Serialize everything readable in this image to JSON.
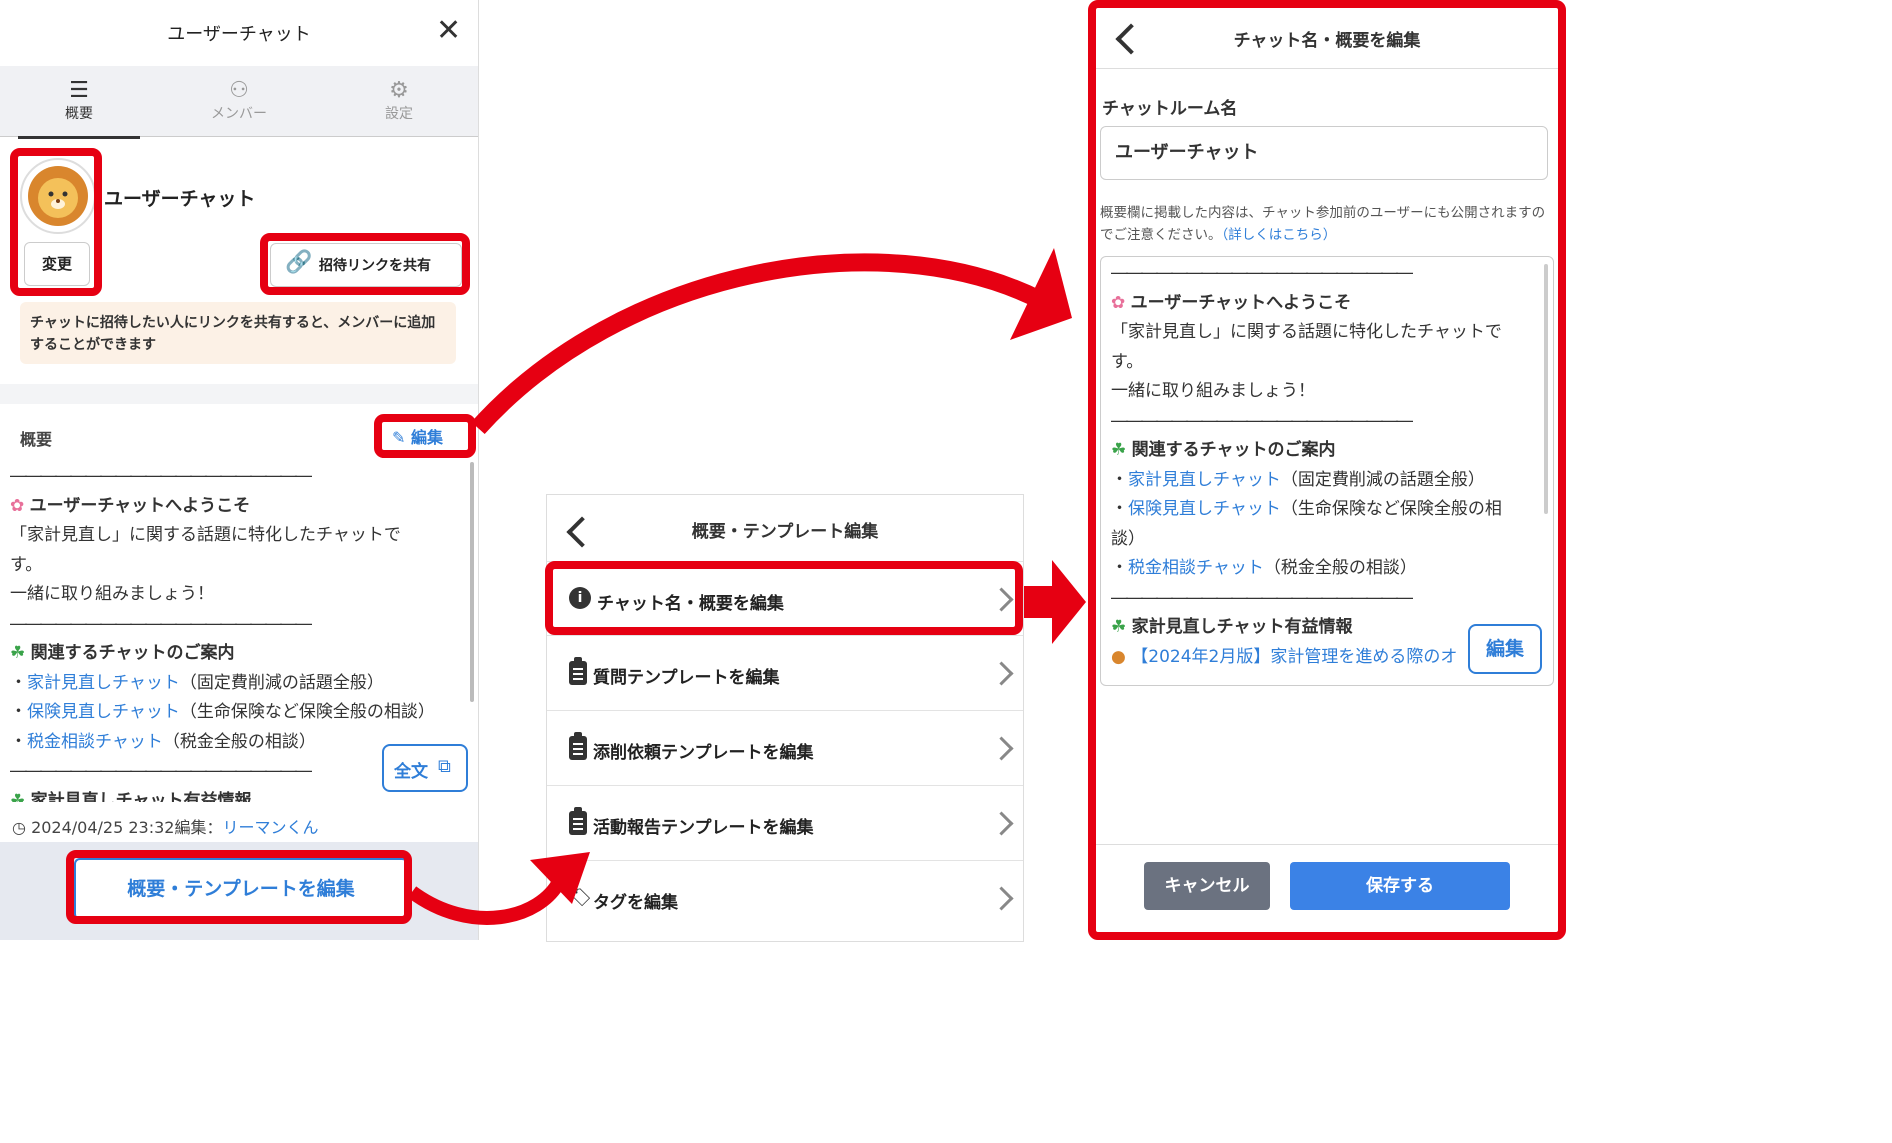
{
  "left": {
    "title": "ユーザーチャット",
    "tabs": [
      {
        "label": "概要",
        "icon": "list-icon"
      },
      {
        "label": "メンバー",
        "icon": "person-icon"
      },
      {
        "label": "設定",
        "icon": "gear-icon"
      }
    ],
    "chat_name": "ユーザーチャット",
    "change_button": "変更",
    "share_button": "招待リンクを共有",
    "tooltip": "チャットに招待したい人にリンクを共有すると、メンバーに追加することができます",
    "overview_label": "概要",
    "edit_label": "編集",
    "overview_lines": {
      "sep": "――――――――――――――――――――",
      "welcome": "ユーザーチャットへようこそ",
      "line1": "「家計見直し」に関する話題に特化したチャットで",
      "line2": "す。",
      "line3": "一緒に取り組みましょう！",
      "related": "関連するチャットのご案内",
      "items": [
        {
          "link": "家計見直しチャット",
          "desc": "（固定費削減の話題全般）"
        },
        {
          "link": "保険見直しチャット",
          "desc": "（生命保険など保険全般の相談）"
        },
        {
          "link": "税金相談チャット",
          "desc": "（税金全般の相談）"
        }
      ],
      "cut": "家計見直しチャット有益情報"
    },
    "fulltext_button": "全文",
    "edited_info": "2024/04/25  23:32編集：",
    "edited_by": "リーマンくん",
    "bottom_button": "概要・テンプレートを編集"
  },
  "middle": {
    "title": "概要・テンプレート編集",
    "items": [
      {
        "label": "チャット名・概要を編集",
        "icon": "info-icon"
      },
      {
        "label": "質問テンプレートを編集",
        "icon": "clipboard-icon"
      },
      {
        "label": "添削依頼テンプレートを編集",
        "icon": "clipboard-icon"
      },
      {
        "label": "活動報告テンプレートを編集",
        "icon": "clipboard-icon"
      },
      {
        "label": "タグを編集",
        "icon": "tag-icon"
      }
    ]
  },
  "right": {
    "title": "チャット名・概要を編集",
    "name_label": "チャットルーム名",
    "name_value": "ユーザーチャット",
    "notice": "概要欄に掲載した内容は、チャット参加前のユーザーにも公開されますのでご注意ください。",
    "notice_link": "（詳しくはこちら）",
    "text_lines": {
      "sep": "――――――――――――――――――――",
      "welcome": "ユーザーチャットへようこそ",
      "line1": "「家計見直し」に関する話題に特化したチャットで",
      "line2": "す。",
      "line3": "一緒に取り組みましょう！",
      "related": "関連するチャットのご案内",
      "items": [
        {
          "link": "家計見直しチャット",
          "desc": "（固定費削減の話題全般）"
        },
        {
          "link": "保険見直しチャット",
          "desc": "（生命保険など保険全般の相"
        },
        {
          "link": "",
          "desc": "談）"
        },
        {
          "link": "税金相談チャット",
          "desc": "（税金全般の相談）"
        }
      ],
      "useful": "家計見直しチャット有益情報",
      "article": "【2024年2月版】家計管理を進める際のオ"
    },
    "edit_tag": "編集",
    "cancel_button": "キャンセル",
    "save_button": "保存する"
  },
  "colors": {
    "accent": "#2f7ed8",
    "highlight": "#e60012",
    "cancel": "#6b7280",
    "save": "#3b82e6"
  }
}
